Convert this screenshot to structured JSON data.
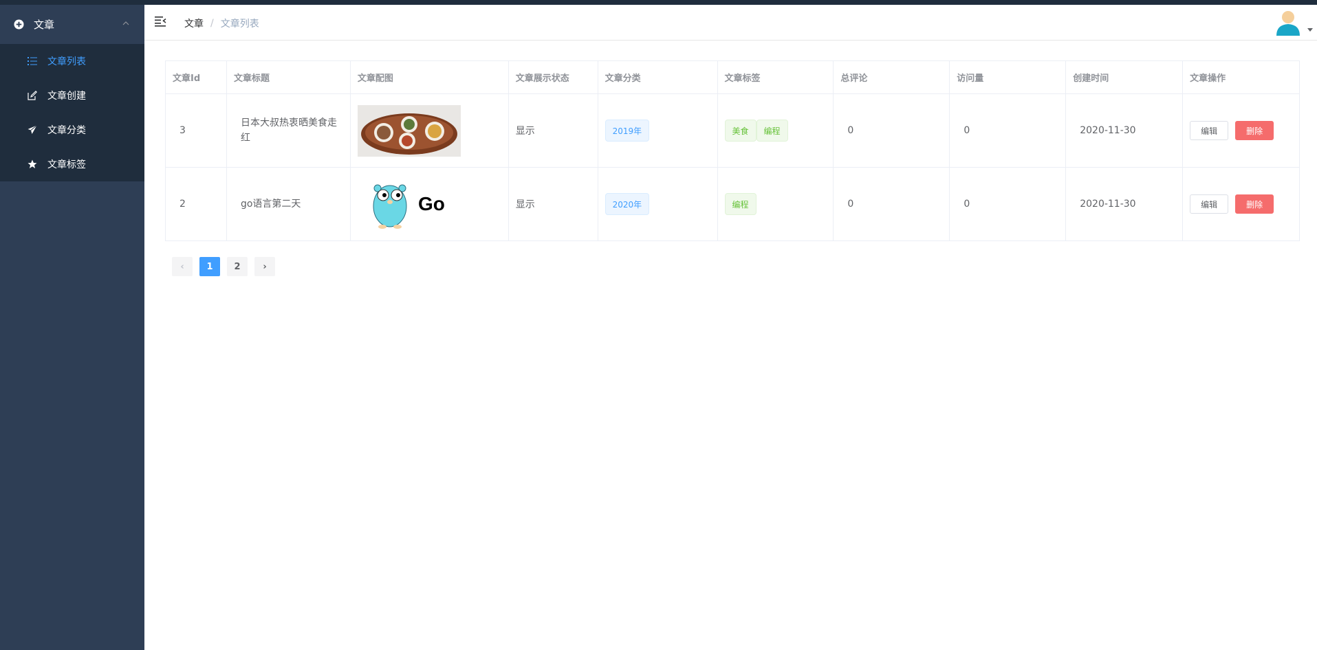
{
  "sidebar": {
    "group_title": "文章",
    "items": [
      {
        "label": "文章列表",
        "icon": "list-icon",
        "active": true
      },
      {
        "label": "文章创建",
        "icon": "edit-icon",
        "active": false
      },
      {
        "label": "文章分类",
        "icon": "send-icon",
        "active": false
      },
      {
        "label": "文章标签",
        "icon": "star-icon",
        "active": false
      }
    ]
  },
  "header": {
    "breadcrumb": [
      "文章",
      "文章列表"
    ],
    "breadcrumb_separator": "/"
  },
  "table": {
    "columns": [
      "文章Id",
      "文章标题",
      "文章配图",
      "文章展示状态",
      "文章分类",
      "文章标签",
      "总评论",
      "访问量",
      "创建时间",
      "文章操作"
    ],
    "rows": [
      {
        "id": "3",
        "title_line1": "日本大叔热衷晒美食走",
        "title_line2": "红",
        "image": "food-plate-photo",
        "status": "显示",
        "category": "2019年",
        "tags": [
          "美食",
          "编程"
        ],
        "comments": "0",
        "views": "0",
        "created": "2020-11-30",
        "edit_label": "编辑",
        "delete_label": "删除"
      },
      {
        "id": "2",
        "title_line1": "go语言第二天",
        "title_line2": "",
        "image": "go-gopher-logo",
        "image_text": "Go",
        "status": "显示",
        "category": "2020年",
        "tags": [
          "编程"
        ],
        "comments": "0",
        "views": "0",
        "created": "2020-11-30",
        "edit_label": "编辑",
        "delete_label": "删除"
      }
    ]
  },
  "pagination": {
    "prev": "‹",
    "next": "›",
    "pages": [
      "1",
      "2"
    ],
    "current": "1"
  },
  "colors": {
    "sidebar_bg": "#2e3e55",
    "submenu_bg": "#1f2d3d",
    "accent": "#409eff",
    "danger": "#f56c6c",
    "success": "#67c23a"
  }
}
